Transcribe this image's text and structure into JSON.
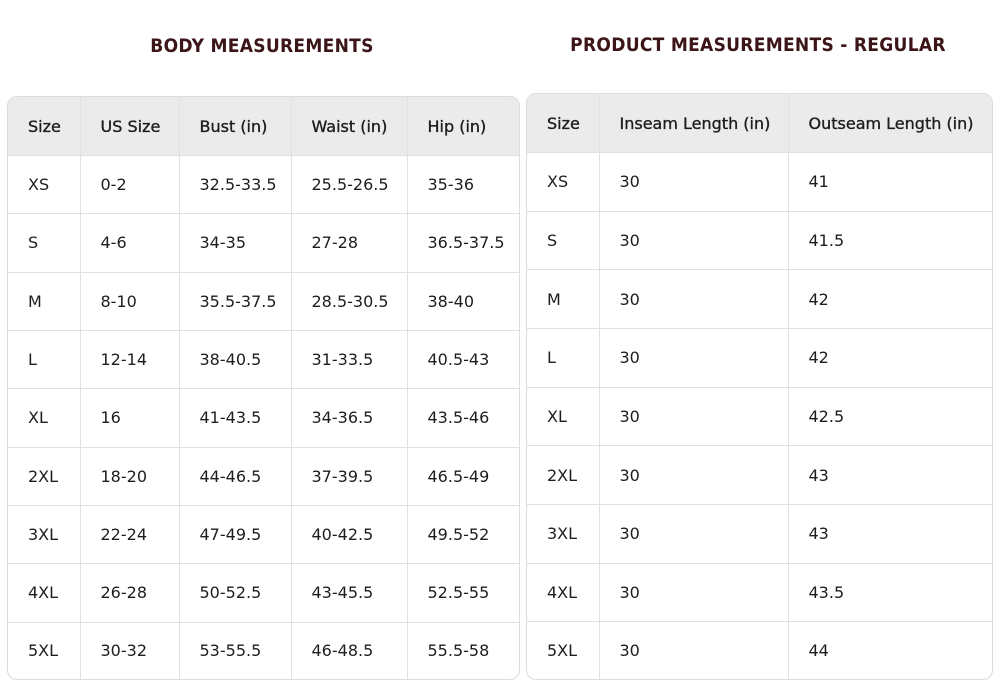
{
  "body_measurements": {
    "title": "BODY MEASUREMENTS",
    "columns": [
      "Size",
      "US Size",
      "Bust (in)",
      "Waist (in)",
      "Hip (in)"
    ],
    "rows": [
      [
        "XS",
        "0-2",
        "32.5-33.5",
        "25.5-26.5",
        "35-36"
      ],
      [
        "S",
        "4-6",
        "34-35",
        "27-28",
        "36.5-37.5"
      ],
      [
        "M",
        "8-10",
        "35.5-37.5",
        "28.5-30.5",
        "38-40"
      ],
      [
        "L",
        "12-14",
        "38-40.5",
        "31-33.5",
        "40.5-43"
      ],
      [
        "XL",
        "16",
        "41-43.5",
        "34-36.5",
        "43.5-46"
      ],
      [
        "2XL",
        "18-20",
        "44-46.5",
        "37-39.5",
        "46.5-49"
      ],
      [
        "3XL",
        "22-24",
        "47-49.5",
        "40-42.5",
        "49.5-52"
      ],
      [
        "4XL",
        "26-28",
        "50-52.5",
        "43-45.5",
        "52.5-55"
      ],
      [
        "5XL",
        "30-32",
        "53-55.5",
        "46-48.5",
        "55.5-58"
      ]
    ]
  },
  "product_measurements": {
    "title": "PRODUCT MEASUREMENTS - REGULAR",
    "columns": [
      "Size",
      "Inseam Length (in)",
      "Outseam Length (in)"
    ],
    "rows": [
      [
        "XS",
        "30",
        "41"
      ],
      [
        "S",
        "30",
        "41.5"
      ],
      [
        "M",
        "30",
        "42"
      ],
      [
        "L",
        "30",
        "42"
      ],
      [
        "XL",
        "30",
        "42.5"
      ],
      [
        "2XL",
        "30",
        "43"
      ],
      [
        "3XL",
        "30",
        "43"
      ],
      [
        "4XL",
        "30",
        "43.5"
      ],
      [
        "5XL",
        "30",
        "44"
      ]
    ]
  },
  "colors": {
    "title_text": "#3b1518",
    "header_background": "#ebebeb",
    "border": "#dcdcdc"
  }
}
